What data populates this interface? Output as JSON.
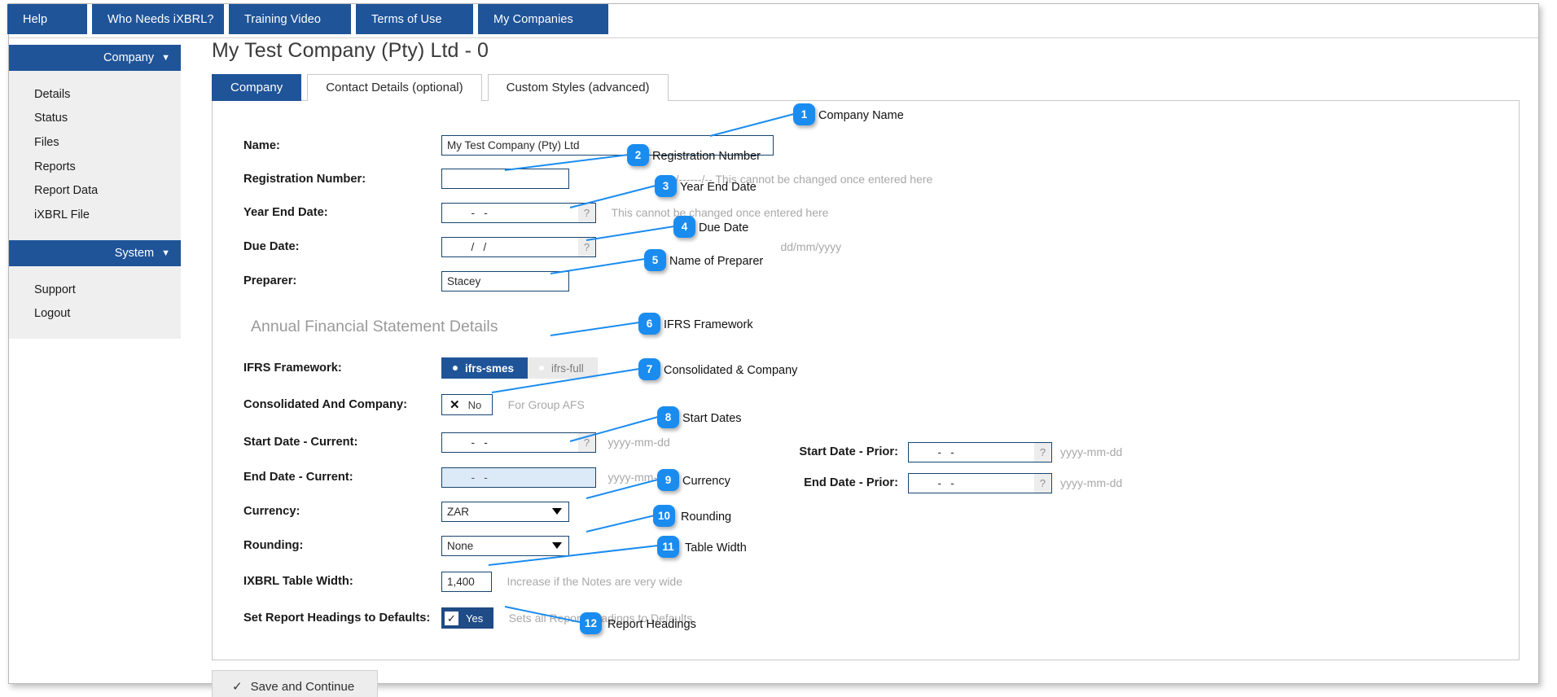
{
  "topnav": {
    "items": [
      {
        "label": "Help"
      },
      {
        "label": "Who Needs iXBRL?"
      },
      {
        "label": "Training Video"
      },
      {
        "label": "Terms of Use"
      },
      {
        "label": "My Companies"
      }
    ]
  },
  "sidebar": {
    "company_header": "Company",
    "company_items": [
      {
        "label": "Details"
      },
      {
        "label": "Status"
      },
      {
        "label": "Files"
      },
      {
        "label": "Reports"
      },
      {
        "label": "Report Data"
      },
      {
        "label": "iXBRL File"
      }
    ],
    "system_header": "System",
    "system_items": [
      {
        "label": "Support"
      },
      {
        "label": "Logout"
      }
    ],
    "caret": "▼"
  },
  "main": {
    "page_title": "My Test Company (Pty) Ltd - 0",
    "tabs": [
      {
        "label": "Company",
        "active": true
      },
      {
        "label": "Contact Details (optional)",
        "active": false
      },
      {
        "label": "Custom Styles (advanced)",
        "active": false
      }
    ],
    "section_heading": "Annual Financial Statement Details",
    "fields": {
      "name": {
        "label": "Name:",
        "value": "My Test Company (Pty) Ltd"
      },
      "registration_number": {
        "label": "Registration Number:",
        "value": "",
        "hint": "----/------/--  This cannot be changed once entered here"
      },
      "year_end_date": {
        "label": "Year End Date:",
        "value": "  -   -",
        "hint": "This cannot be changed once entered here",
        "help": "?"
      },
      "due_date": {
        "label": "Due Date:",
        "value": "  /   /",
        "hint": "dd/mm/yyyy",
        "help": "?"
      },
      "preparer": {
        "label": "Preparer:",
        "value": "Stacey"
      },
      "ifrs_framework": {
        "label": "IFRS Framework:",
        "options": [
          "ifrs-smes",
          "ifrs-full"
        ],
        "selected": "ifrs-smes"
      },
      "consolidated": {
        "label": "Consolidated And Company:",
        "value": "No",
        "icon": "✕",
        "hint": "For Group AFS"
      },
      "start_date_current": {
        "label": "Start Date - Current:",
        "value": "  -   -",
        "hint": "yyyy-mm-dd",
        "help": "?"
      },
      "end_date_current": {
        "label": "End Date - Current:",
        "value": "  -   -",
        "hint": "yyyy-mm-dd"
      },
      "currency": {
        "label": "Currency:",
        "value": "ZAR",
        "options": [
          "ZAR"
        ]
      },
      "rounding": {
        "label": "Rounding:",
        "value": "None",
        "options": [
          "None"
        ]
      },
      "table_width": {
        "label": "IXBRL Table Width:",
        "value": "1,400",
        "hint": "Increase if the Notes are very wide"
      },
      "report_headings": {
        "label": "Set Report Headings to Defaults:",
        "value": "Yes",
        "icon": "✓",
        "hint": "Sets all Report Headings to Defaults"
      },
      "start_date_prior": {
        "label": "Start Date - Prior:",
        "value": "  -   -",
        "hint": "yyyy-mm-dd",
        "help": "?"
      },
      "end_date_prior": {
        "label": "End Date - Prior:",
        "value": "  -   -",
        "hint": "yyyy-mm-dd",
        "help": "?"
      }
    },
    "save_button": {
      "label": "Save and Continue",
      "icon": "✓"
    }
  },
  "callouts": [
    {
      "num": "1",
      "label": "Company Name"
    },
    {
      "num": "2",
      "label": "Registration Number"
    },
    {
      "num": "3",
      "label": "Year End Date"
    },
    {
      "num": "4",
      "label": "Due Date"
    },
    {
      "num": "5",
      "label": "Name of Preparer"
    },
    {
      "num": "6",
      "label": "IFRS Framework"
    },
    {
      "num": "7",
      "label": "Consolidated & Company"
    },
    {
      "num": "8",
      "label": "Start Dates"
    },
    {
      "num": "9",
      "label": "Currency"
    },
    {
      "num": "10",
      "label": "Rounding"
    },
    {
      "num": "11",
      "label": "Table Width"
    },
    {
      "num": "12",
      "label": "Report Headings"
    }
  ],
  "colors": {
    "nav_blue": "#1f5499",
    "badge_blue": "#1a8cf0",
    "leader_line": "#1a8cf0",
    "disabled_field": "#dceaf7"
  }
}
